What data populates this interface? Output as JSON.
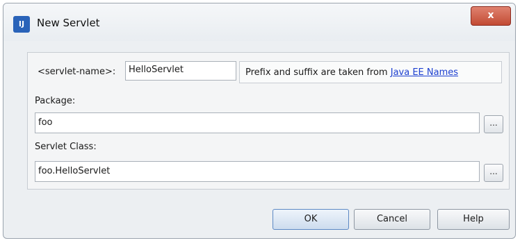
{
  "window": {
    "title": "New Servlet",
    "icon_name": "intellij-idea-icon",
    "icon_glyph": "IJ",
    "close_glyph": "x"
  },
  "servlet_name": {
    "label": "<servlet-name>:",
    "value": "HelloServlet",
    "hint_text": "Prefix and suffix are taken from",
    "hint_link": "Java EE Names"
  },
  "package": {
    "label": "Package:",
    "value": "foo",
    "browse_label": "..."
  },
  "servlet_class": {
    "label": "Servlet Class:",
    "value": "foo.HelloServlet",
    "browse_label": "..."
  },
  "buttons": {
    "ok": "OK",
    "cancel": "Cancel",
    "help": "Help"
  },
  "colors": {
    "link": "#1c3fd0",
    "close_button": "#c24b34",
    "app_icon": "#2a63b9"
  }
}
